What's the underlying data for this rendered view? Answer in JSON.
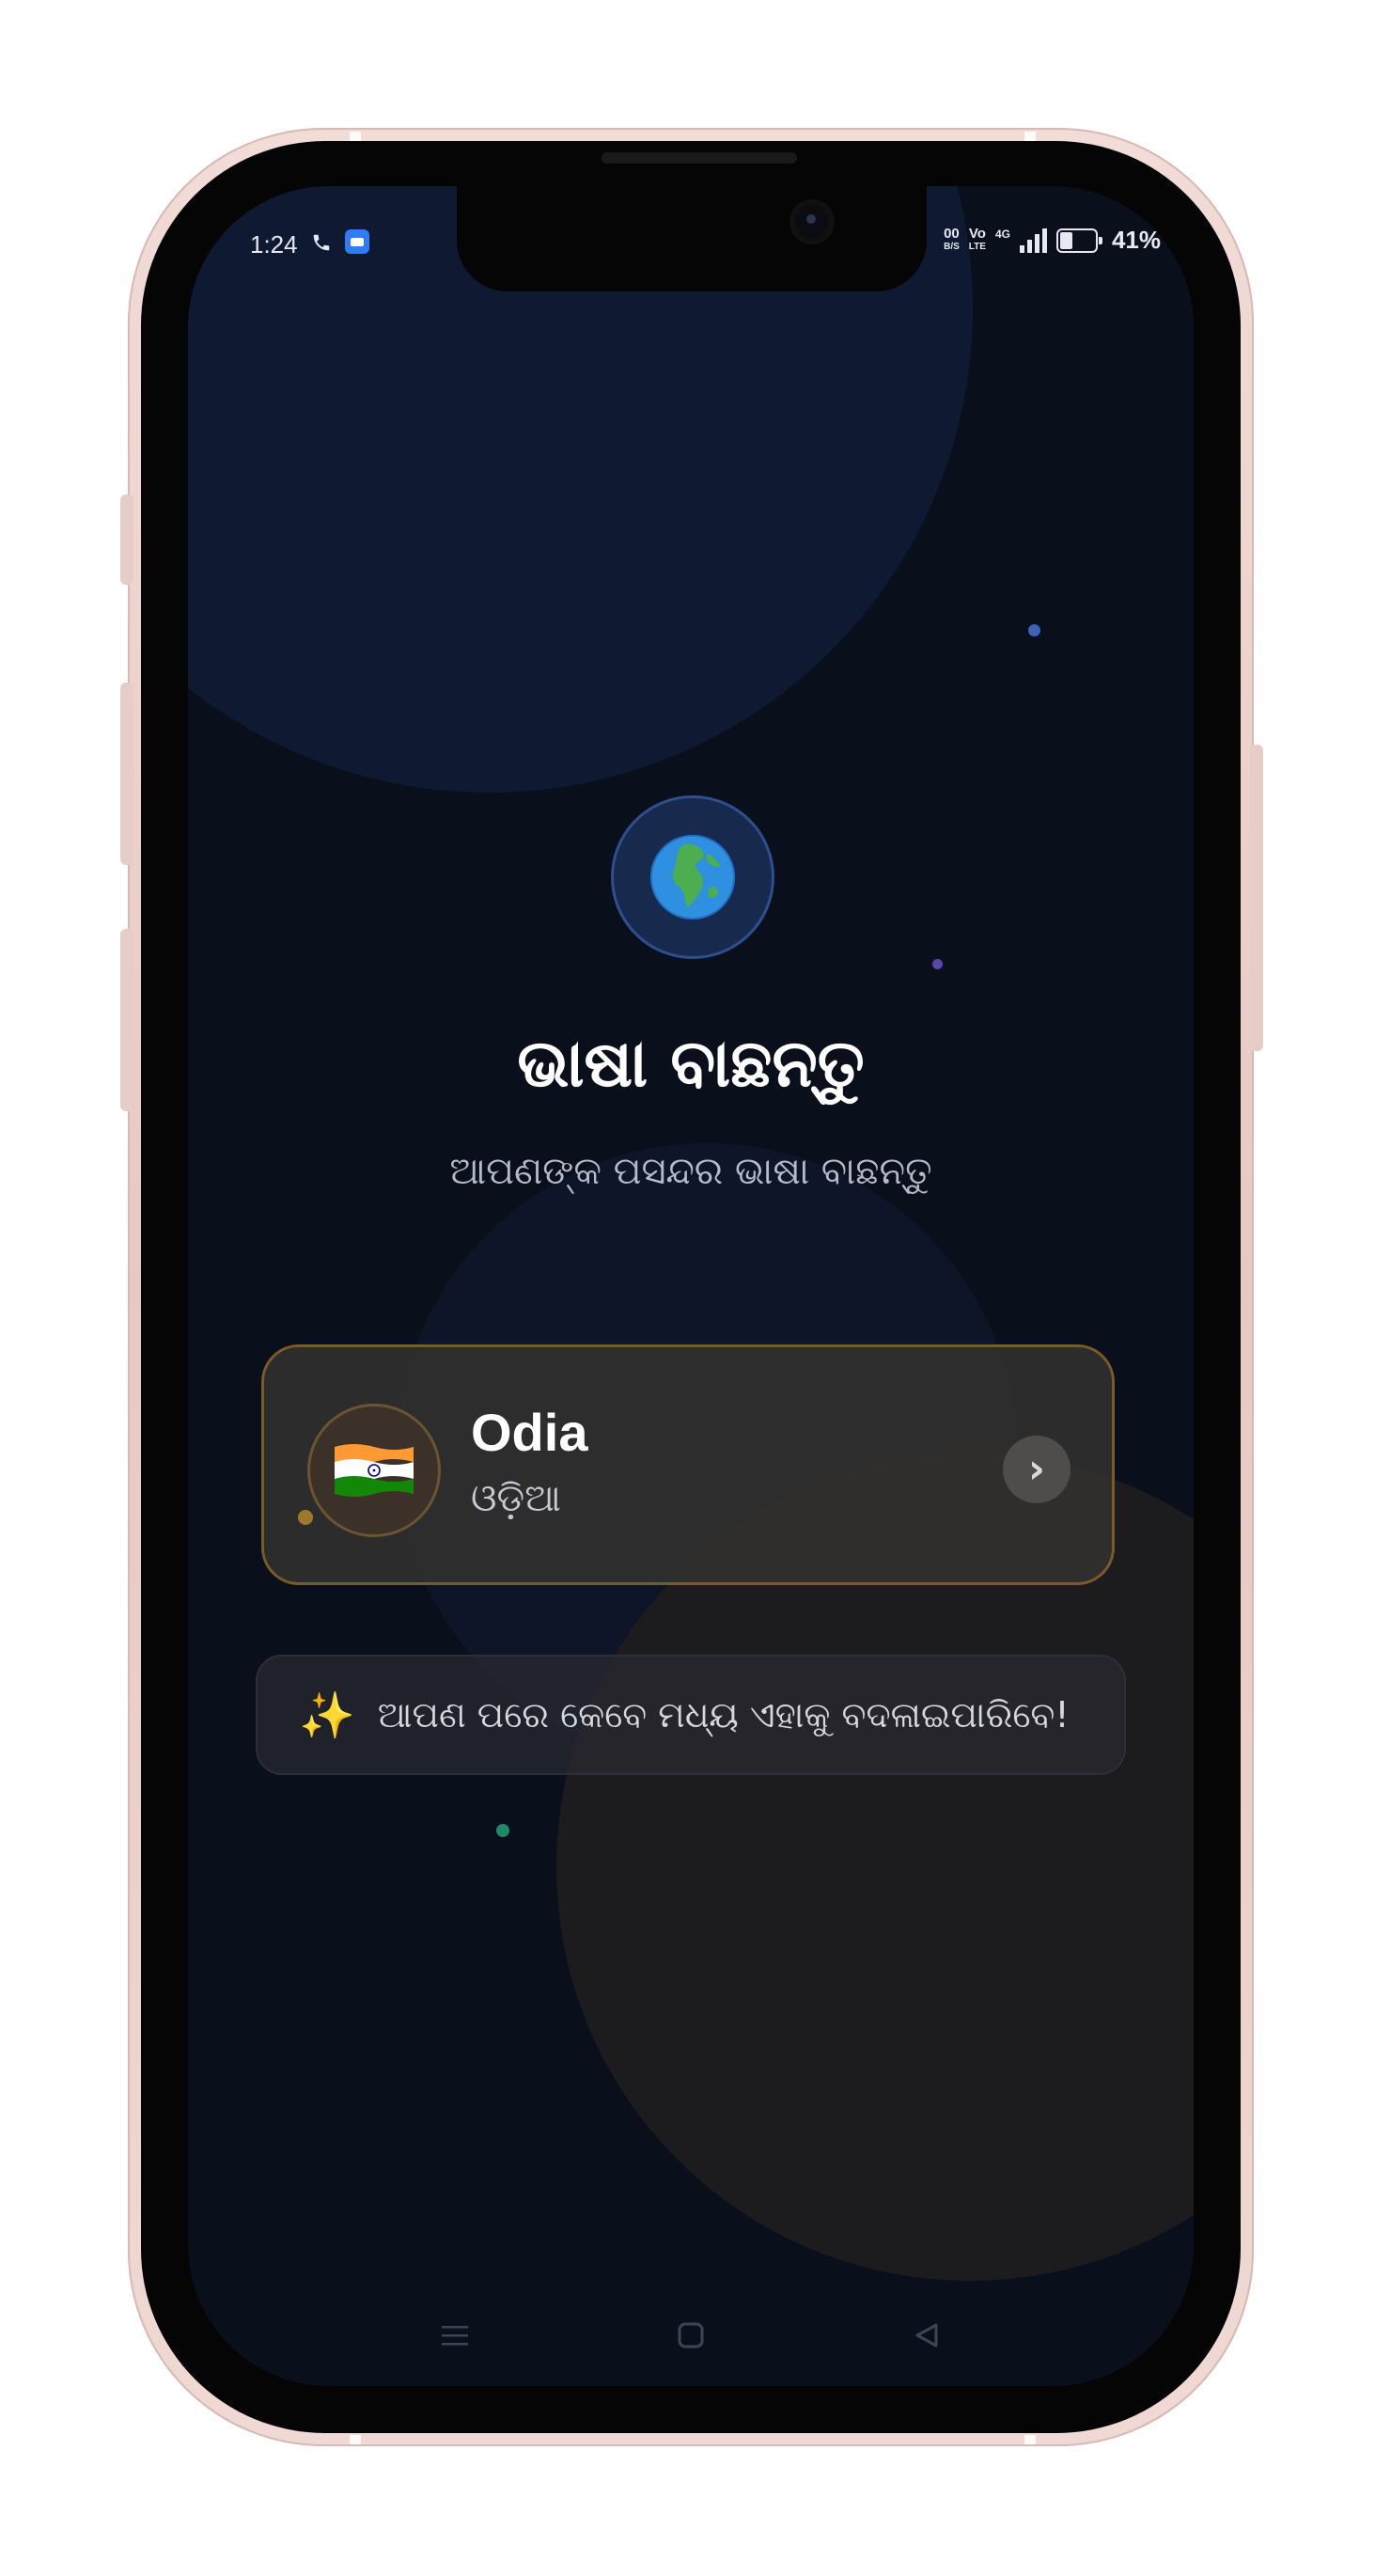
{
  "status_bar": {
    "time": "1:24",
    "speed_top": "00",
    "speed_bottom": "B/S",
    "volte_top": "Vo",
    "volte_bottom": "LTE",
    "network": "4G",
    "battery_percent": "41%",
    "battery_level": 0.41
  },
  "header": {
    "title": "ଭାଷା ବାଛନ୍ତୁ",
    "subtitle": "ଆପଣଙ୍କ ପସନ୍ଦର ଭାଷା ବାଛନ୍ତୁ"
  },
  "language_option": {
    "name": "Odia",
    "native_name": "ଓଡ଼ିଆ",
    "chevron": "›"
  },
  "hint": {
    "icon": "✨",
    "text": "ଆପଣ ପରେ କେବେ ମଧ୍ୟ ଏହାକୁ ବଦଳାଇପାରିବେ!"
  },
  "icons": {
    "globe": "globe-icon",
    "flag": "india-flag-icon",
    "nav_menu": "menu-icon",
    "nav_home": "home-icon",
    "nav_back": "back-icon"
  },
  "colors": {
    "background": "#0a0f1c",
    "card_border": "#7a5a26",
    "accent_gold": "#9b7a2c"
  }
}
